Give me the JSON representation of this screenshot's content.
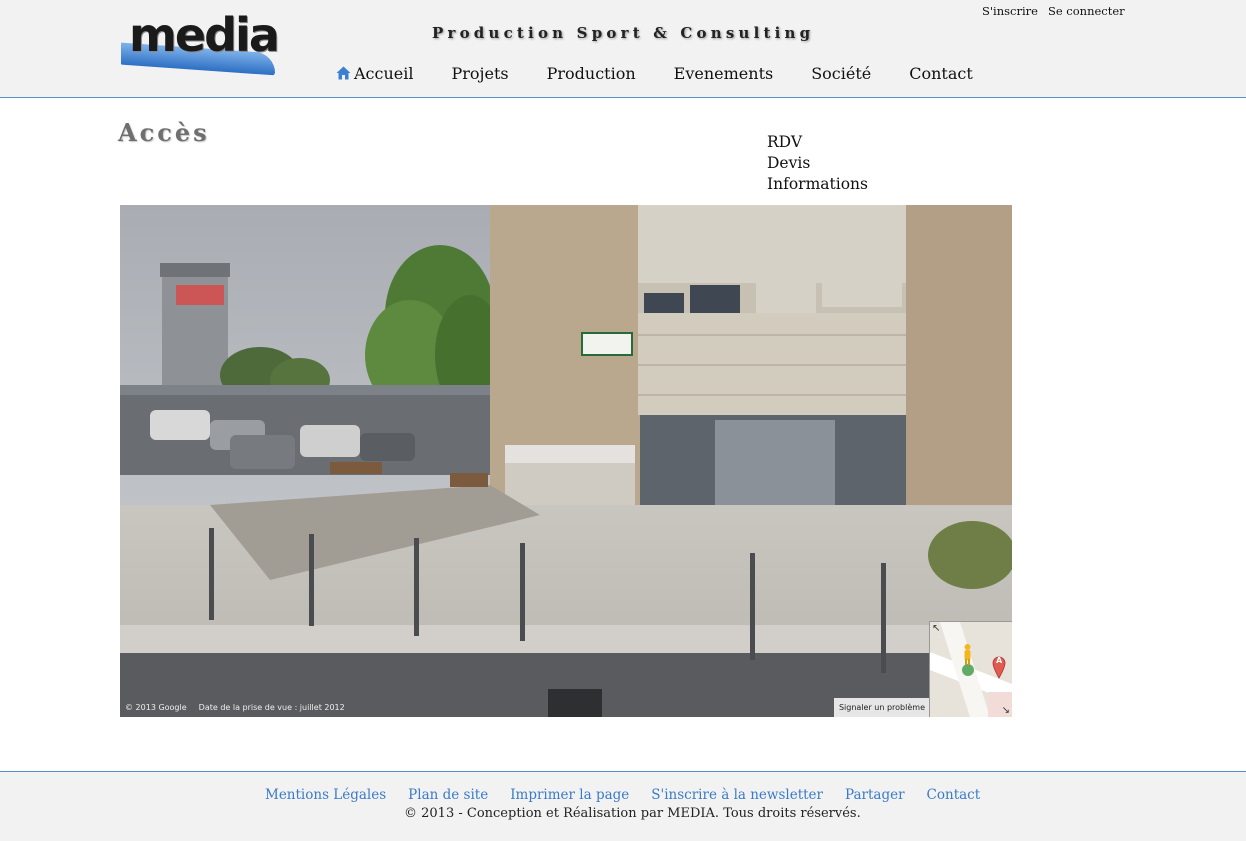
{
  "header": {
    "logo_text": "media",
    "tagline": "Production Sport & Consulting",
    "auth": {
      "signup": "S'inscrire",
      "login": "Se connecter"
    },
    "nav": [
      {
        "label": "Accueil",
        "icon": "home-icon"
      },
      {
        "label": "Projets"
      },
      {
        "label": "Production"
      },
      {
        "label": "Evenements"
      },
      {
        "label": "Société"
      },
      {
        "label": "Contact"
      }
    ]
  },
  "main": {
    "title": "Accès",
    "side_links": [
      "RDV",
      "Devis",
      "Informations"
    ],
    "streetview": {
      "copyright": "© 2013 Google",
      "capture_date": "Date de la prise de vue : juillet 2012",
      "report_label": "Signaler un problème",
      "marker_label": "A"
    }
  },
  "footer": {
    "links": [
      "Mentions Légales",
      "Plan de site",
      "Imprimer la page",
      "S'inscrire à la newsletter",
      "Partager",
      "Contact"
    ],
    "copyright": "© 2013 - Conception et Réalisation par MEDIA. Tous droits réservés."
  },
  "colors": {
    "accent": "#3a7bc8",
    "header_bg": "#f2f2f2",
    "divider": "#5b8fc9"
  }
}
